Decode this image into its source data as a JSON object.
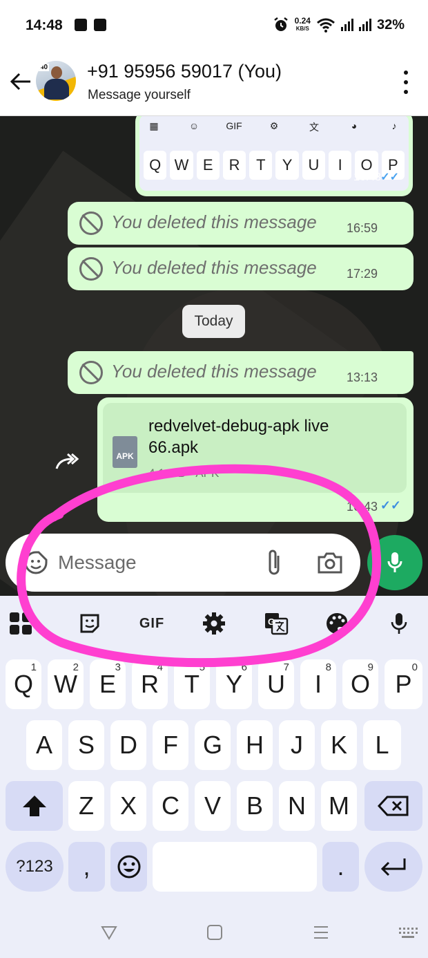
{
  "status_bar": {
    "time": "14:48",
    "net_speed": "0.24",
    "net_unit": "KB/S",
    "battery": "32%"
  },
  "header": {
    "avatar_badge": "40",
    "contact_name": "+91 95956 59017 (You)",
    "subtitle": "Message yourself"
  },
  "chat": {
    "image_message": {
      "toolbar_gif": "GIF",
      "keys": [
        "Q",
        "W",
        "E",
        "R",
        "T",
        "Y",
        "U",
        "I",
        "O",
        "P"
      ],
      "time": "16:43",
      "ticks": "✓✓"
    },
    "deleted_messages": [
      {
        "text": "You deleted this message",
        "time": "16:59"
      },
      {
        "text": "You deleted this message",
        "time": "17:29"
      },
      {
        "text": "You deleted this message",
        "time": "13:13"
      }
    ],
    "date_separator": "Today",
    "file_message": {
      "icon_label": "APK",
      "file_name": "redvelvet-debug-apk live 66.apk",
      "meta": "4.1 MB • APK",
      "time": "16:43",
      "ticks": "✓✓"
    }
  },
  "input_bar": {
    "placeholder": "Message"
  },
  "keyboard": {
    "toolbar": {
      "gif": "GIF"
    },
    "row1": [
      {
        "label": "Q",
        "hint": "1"
      },
      {
        "label": "W",
        "hint": "2"
      },
      {
        "label": "E",
        "hint": "3"
      },
      {
        "label": "R",
        "hint": "4"
      },
      {
        "label": "T",
        "hint": "5"
      },
      {
        "label": "Y",
        "hint": "6"
      },
      {
        "label": "U",
        "hint": "7"
      },
      {
        "label": "I",
        "hint": "8"
      },
      {
        "label": "O",
        "hint": "9"
      },
      {
        "label": "P",
        "hint": "0"
      }
    ],
    "row2": [
      "A",
      "S",
      "D",
      "F",
      "G",
      "H",
      "J",
      "K",
      "L"
    ],
    "row3": [
      "Z",
      "X",
      "C",
      "V",
      "B",
      "N",
      "M"
    ],
    "symbols_key": "?123",
    "comma_key": ",",
    "period_key": "."
  },
  "colors": {
    "bubble": "#d9fdd3",
    "accent_green": "#1daa61",
    "annotation": "#ff3fd0",
    "read_ticks": "#3f8fe0",
    "keyboard_bg": "#eceef9"
  }
}
